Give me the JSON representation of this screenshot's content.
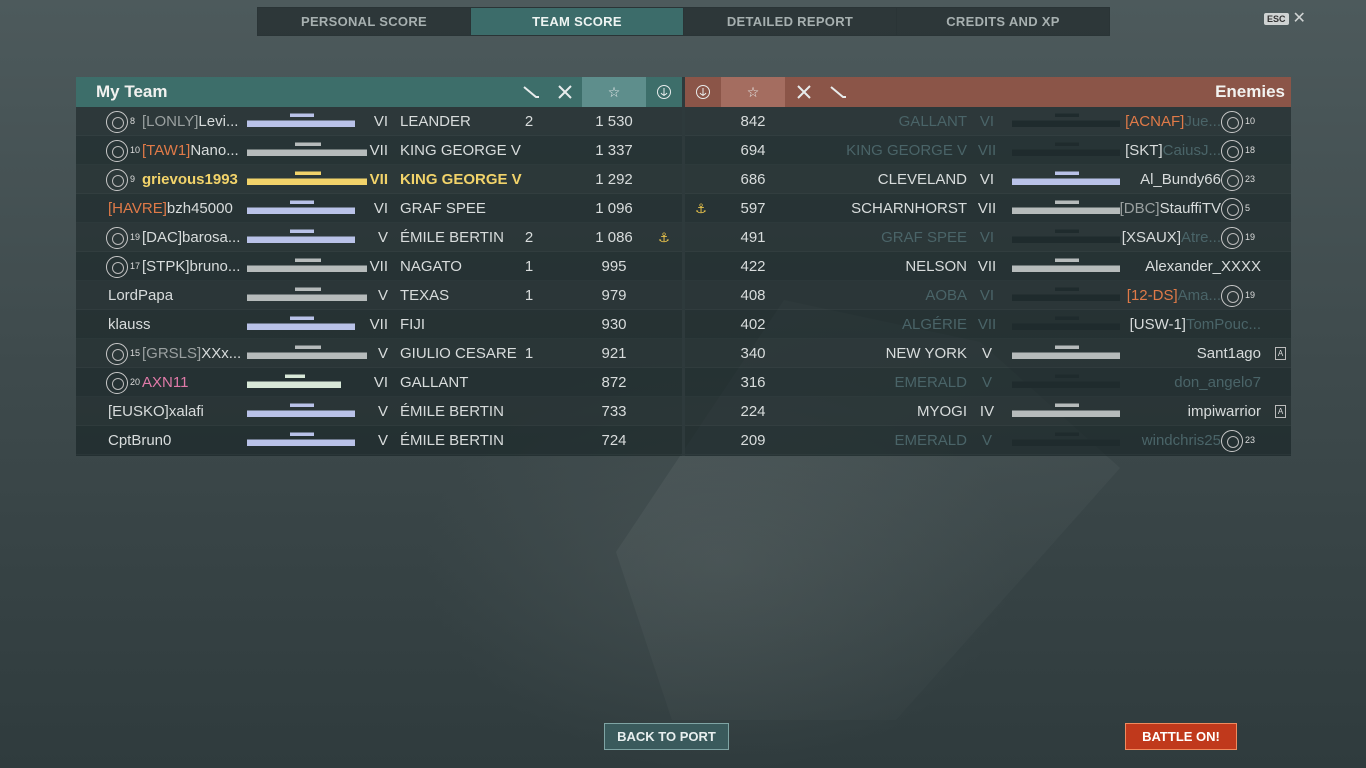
{
  "tabs": [
    "PERSONAL SCORE",
    "TEAM SCORE",
    "DETAILED REPORT",
    "CREDITS AND XP"
  ],
  "active_tab": "TEAM SCORE",
  "esc": {
    "key": "ESC",
    "close": "✕"
  },
  "my_team": {
    "title": "My Team",
    "icons": {
      "torpedo": "torpedo-icon",
      "planes": "planes-killed-icon",
      "score": "☆",
      "base": "anchor-icon"
    },
    "rows": [
      {
        "rank": "8",
        "clan": "[LONLY]",
        "clan_style": "clan-gray",
        "name": "Levi...",
        "ship_color": "sil-light",
        "tier": "VI",
        "ship": "LEANDER",
        "torp": "2",
        "score": "1 530",
        "base": ""
      },
      {
        "rank": "10",
        "clan": "[TAW1]",
        "clan_style": "clan-orange",
        "name": "Nano...",
        "ship_color": "sil-gray",
        "tier": "VII",
        "ship": "KING GEORGE V",
        "torp": "",
        "score": "1 337",
        "base": ""
      },
      {
        "rank": "9",
        "clan": "",
        "clan_style": "clan-white",
        "name": "grievous1993",
        "ship_color": "sil-gold",
        "tier": "VII",
        "ship": "KING GEORGE V",
        "torp": "",
        "score": "1 292",
        "base": "",
        "self": true
      },
      {
        "rank": "",
        "clan": "[HAVRE]",
        "clan_style": "clan-orange",
        "name": "bzh45000",
        "ship_color": "sil-light",
        "tier": "VI",
        "ship": "GRAF SPEE",
        "torp": "",
        "score": "1 096",
        "base": ""
      },
      {
        "rank": "19",
        "clan": "[DAC]",
        "clan_style": "clan-white",
        "name": "barosa...",
        "ship_color": "sil-light",
        "tier": "V",
        "ship": "ÉMILE BERTIN",
        "torp": "2",
        "score": "1 086",
        "base": "⚓"
      },
      {
        "rank": "17",
        "clan": "[STPK]",
        "clan_style": "clan-white",
        "name": "bruno...",
        "ship_color": "sil-gray",
        "tier": "VII",
        "ship": "NAGATO",
        "torp": "1",
        "score": "995",
        "base": ""
      },
      {
        "rank": "",
        "clan": "",
        "clan_style": "clan-white",
        "name": "LordPapa",
        "ship_color": "sil-gray",
        "tier": "V",
        "ship": "TEXAS",
        "torp": "1",
        "score": "979",
        "base": ""
      },
      {
        "rank": "",
        "clan": "",
        "clan_style": "clan-white",
        "name": "klauss",
        "ship_color": "sil-light",
        "tier": "VII",
        "ship": "FIJI",
        "torp": "",
        "score": "930",
        "base": ""
      },
      {
        "rank": "15",
        "clan": "[GRSLS]",
        "clan_style": "clan-gray",
        "name": "XXx...",
        "ship_color": "sil-gray",
        "tier": "V",
        "ship": "GIULIO CESARE",
        "torp": "1",
        "score": "921",
        "base": ""
      },
      {
        "rank": "20",
        "clan": "",
        "clan_style": "name-pink",
        "name": "AXN11",
        "ship_color": "sil-green",
        "tier": "VI",
        "ship": "GALLANT",
        "torp": "",
        "score": "872",
        "base": "",
        "pink": true
      },
      {
        "rank": "",
        "clan": "[EUSKO]",
        "clan_style": "clan-white",
        "name": "xalafi",
        "ship_color": "sil-light",
        "tier": "V",
        "ship": "ÉMILE BERTIN",
        "torp": "",
        "score": "733",
        "base": ""
      },
      {
        "rank": "",
        "clan": "",
        "clan_style": "clan-white",
        "name": "CptBrun0",
        "ship_color": "sil-light",
        "tier": "V",
        "ship": "ÉMILE BERTIN",
        "torp": "",
        "score": "724",
        "base": ""
      }
    ]
  },
  "enemies": {
    "title": "Enemies",
    "rows": [
      {
        "base": "",
        "score": "842",
        "ship": "GALLANT",
        "tier": "VI",
        "clan": "[ACNAF]",
        "clan_style": "clan-orange",
        "name": "Jue...",
        "rank": "10",
        "dead": true,
        "ship_color": "sil-dark"
      },
      {
        "base": "",
        "score": "694",
        "ship": "KING GEORGE V",
        "tier": "VII",
        "clan": "[SKT]",
        "clan_style": "clan-white",
        "name": "CaiusJ...",
        "rank": "18",
        "dead": true,
        "ship_color": "sil-dark"
      },
      {
        "base": "",
        "score": "686",
        "ship": "CLEVELAND",
        "tier": "VI",
        "clan": "",
        "clan_style": "clan-white",
        "name": "Al_Bundy66",
        "rank": "23",
        "dead": false,
        "ship_color": "sil-light"
      },
      {
        "base": "⚓",
        "score": "597",
        "ship": "SCHARNHORST",
        "tier": "VII",
        "clan": "[DBC]",
        "clan_style": "clan-gray",
        "name": "StauffiTV",
        "rank": "5",
        "dead": false,
        "ship_color": "sil-gray"
      },
      {
        "base": "",
        "score": "491",
        "ship": "GRAF SPEE",
        "tier": "VI",
        "clan": "[XSAUX]",
        "clan_style": "clan-white",
        "name": "Atre...",
        "rank": "19",
        "dead": true,
        "ship_color": "sil-dark"
      },
      {
        "base": "",
        "score": "422",
        "ship": "NELSON",
        "tier": "VII",
        "clan": "",
        "clan_style": "clan-white",
        "name": "Alexander_XXXX",
        "rank": "",
        "dead": false,
        "ship_color": "sil-gray"
      },
      {
        "base": "",
        "score": "408",
        "ship": "AOBA",
        "tier": "VI",
        "clan": "[12-DS]",
        "clan_style": "clan-orange",
        "name": "Ama...",
        "rank": "19",
        "dead": true,
        "ship_color": "sil-dark"
      },
      {
        "base": "",
        "score": "402",
        "ship": "ALGÉRIE",
        "tier": "VII",
        "clan": "[USW-1]",
        "clan_style": "clan-white",
        "name": "TomPouc...",
        "rank": "",
        "dead": true,
        "ship_color": "sil-dark"
      },
      {
        "base": "",
        "score": "340",
        "ship": "NEW YORK",
        "tier": "V",
        "clan": "",
        "clan_style": "clan-white",
        "name": "Sant1ago",
        "rank": "",
        "dead": false,
        "badge": "A",
        "ship_color": "sil-gray"
      },
      {
        "base": "",
        "score": "316",
        "ship": "EMERALD",
        "tier": "V",
        "clan": "",
        "clan_style": "clan-white",
        "name": "don_angelo7",
        "rank": "",
        "dead": true,
        "ship_color": "sil-dark"
      },
      {
        "base": "",
        "score": "224",
        "ship": "MYOGI",
        "tier": "IV",
        "clan": "",
        "clan_style": "clan-white",
        "name": "impiwarrior",
        "rank": "",
        "dead": false,
        "badge": "A",
        "ship_color": "sil-gray"
      },
      {
        "base": "",
        "score": "209",
        "ship": "EMERALD",
        "tier": "V",
        "clan": "",
        "clan_style": "clan-white",
        "name": "windchris25",
        "rank": "23",
        "dead": true,
        "ship_color": "sil-dark"
      }
    ]
  },
  "buttons": {
    "back": "BACK TO PORT",
    "battle": "BATTLE ON!"
  }
}
